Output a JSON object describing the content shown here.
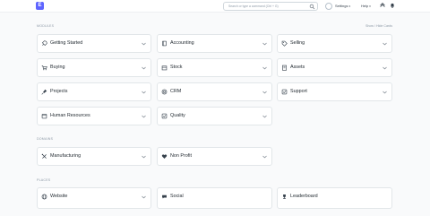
{
  "navbar": {
    "logo_letter": "E",
    "search_placeholder": "Search or type a command (Ctrl + G)",
    "settings_label": "Settings",
    "help_label": "Help"
  },
  "sections": {
    "modules_title": "Modules",
    "show_hide_label": "Show / Hide Cards",
    "domains_title": "Domains",
    "places_title": "Places"
  },
  "modules": [
    {
      "label": "Getting Started",
      "icon": "rocket-icon"
    },
    {
      "label": "Accounting",
      "icon": "book-icon"
    },
    {
      "label": "Selling",
      "icon": "tag-icon"
    },
    {
      "label": "Buying",
      "icon": "cart-icon"
    },
    {
      "label": "Stock",
      "icon": "box-icon"
    },
    {
      "label": "Assets",
      "icon": "building-icon"
    },
    {
      "label": "Projects",
      "icon": "pin-icon"
    },
    {
      "label": "CRM",
      "icon": "target-icon"
    },
    {
      "label": "Support",
      "icon": "check-icon"
    },
    {
      "label": "Human Resources",
      "icon": "calendar-icon"
    },
    {
      "label": "Quality",
      "icon": "check-icon"
    }
  ],
  "domains": [
    {
      "label": "Manufacturing",
      "icon": "tools-icon"
    },
    {
      "label": "Non Profit",
      "icon": "heart-icon"
    }
  ],
  "places": [
    {
      "label": "Website",
      "icon": "globe-icon"
    },
    {
      "label": "Social",
      "icon": "chat-icon"
    },
    {
      "label": "Leaderboard",
      "icon": "trophy-icon"
    }
  ]
}
